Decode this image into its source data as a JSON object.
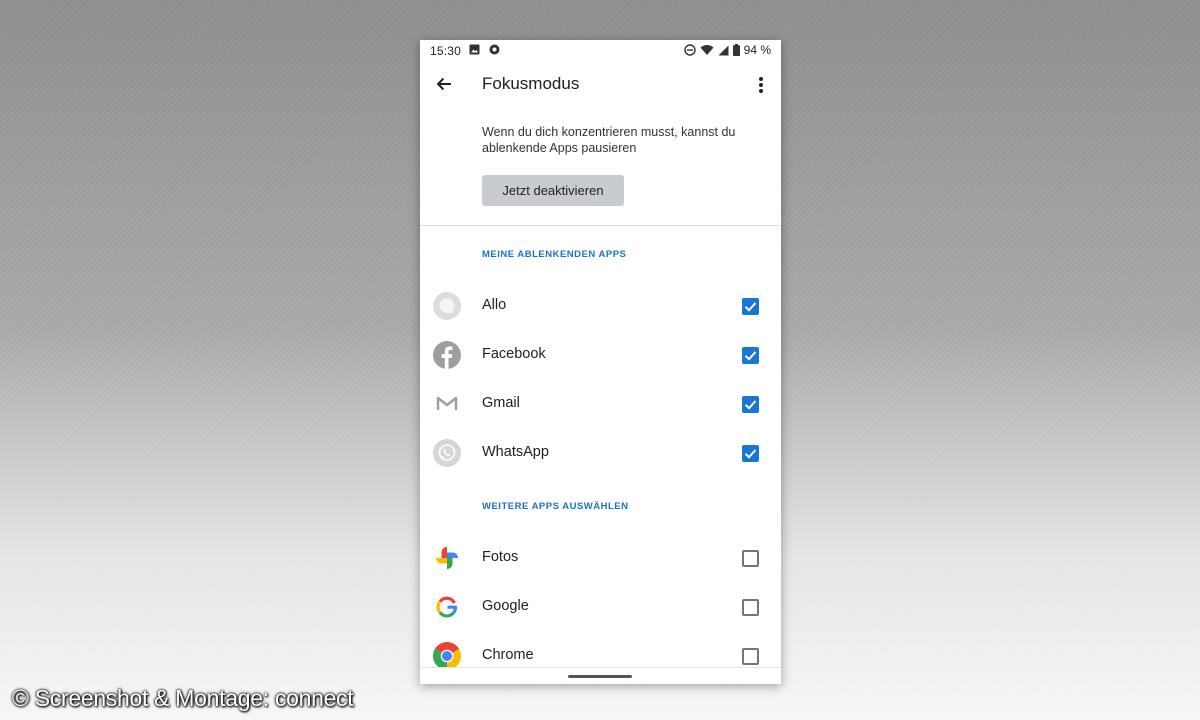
{
  "status_bar": {
    "time": "15:30",
    "battery": "94 %"
  },
  "app_bar": {
    "title": "Fokusmodus"
  },
  "intro": {
    "description": "Wenn du dich konzentrieren musst, kannst du ablenkende Apps pausieren",
    "action_label": "Jetzt deaktivieren"
  },
  "sections": {
    "distracting": {
      "header": "MEINE ABLENKENDEN APPS",
      "apps": [
        {
          "name": "Allo",
          "icon": "allo-icon",
          "checked": true
        },
        {
          "name": "Facebook",
          "icon": "facebook-icon",
          "checked": true
        },
        {
          "name": "Gmail",
          "icon": "gmail-icon",
          "checked": true
        },
        {
          "name": "WhatsApp",
          "icon": "whatsapp-icon",
          "checked": true
        }
      ]
    },
    "more": {
      "header": "WEITERE APPS AUSWÄHLEN",
      "apps": [
        {
          "name": "Fotos",
          "icon": "photos-icon",
          "checked": false
        },
        {
          "name": "Google",
          "icon": "google-icon",
          "checked": false
        },
        {
          "name": "Chrome",
          "icon": "chrome-icon",
          "checked": false
        }
      ]
    }
  },
  "colors": {
    "accent": "#1976d2",
    "section_header": "#1a73c8",
    "button_bg": "#c8cbd0"
  },
  "watermark": "© Screenshot & Montage: connect"
}
